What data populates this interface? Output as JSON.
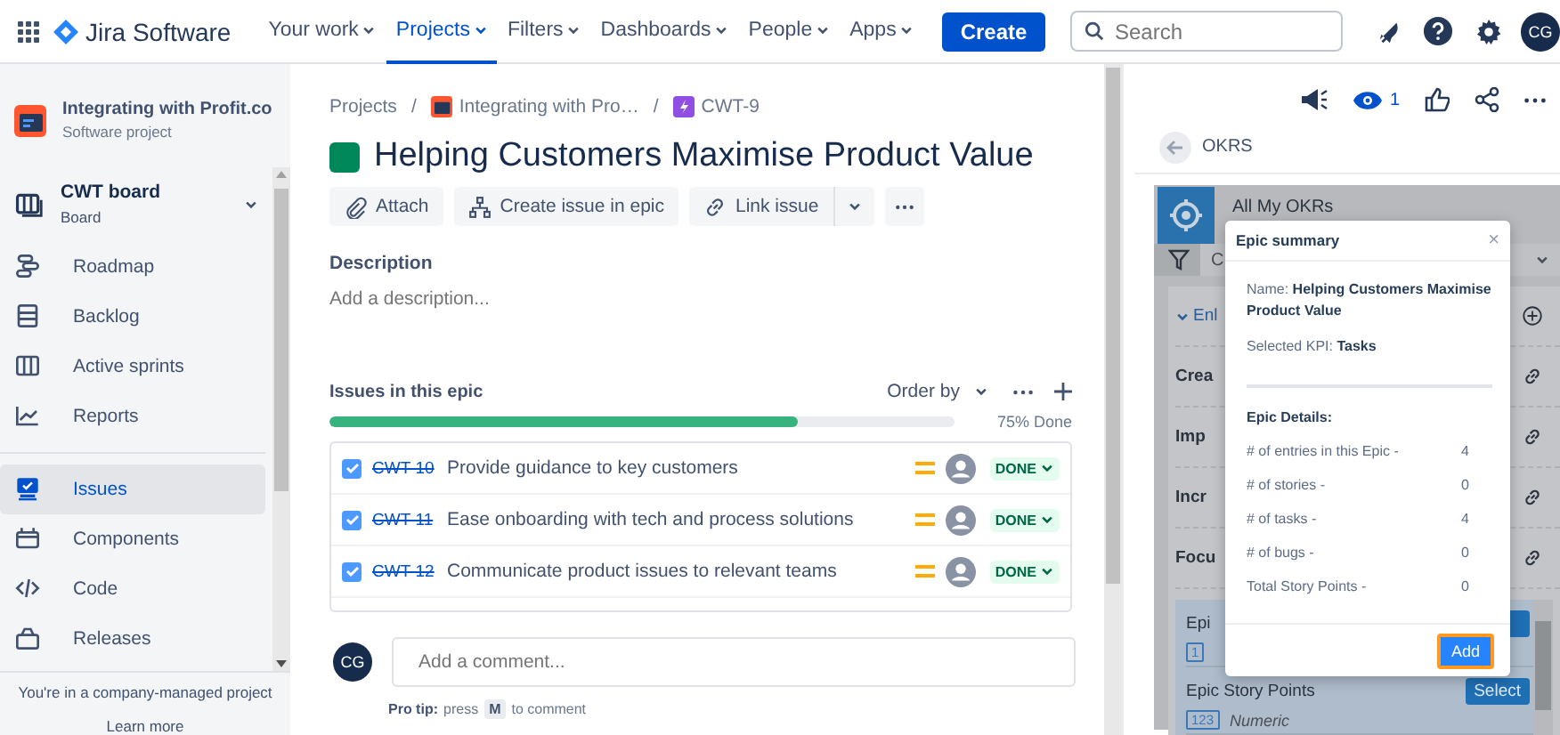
{
  "topbar": {
    "product": "Jira Software",
    "nav": [
      {
        "label": "Your work",
        "selected": false
      },
      {
        "label": "Projects",
        "selected": true
      },
      {
        "label": "Filters",
        "selected": false
      },
      {
        "label": "Dashboards",
        "selected": false
      },
      {
        "label": "People",
        "selected": false
      },
      {
        "label": "Apps",
        "selected": false
      }
    ],
    "create": "Create",
    "search": {
      "placeholder": "Search"
    },
    "avatar": "CG"
  },
  "sidebar": {
    "project": {
      "name": "Integrating with Profit.co",
      "type": "Software project"
    },
    "board": {
      "name": "CWT board",
      "subtitle": "Board"
    },
    "items": [
      {
        "label": "Roadmap",
        "kind": "roadmap",
        "selected": false
      },
      {
        "label": "Backlog",
        "kind": "backlog",
        "selected": false
      },
      {
        "label": "Active sprints",
        "kind": "sprints",
        "selected": false
      },
      {
        "label": "Reports",
        "kind": "reports",
        "selected": false
      },
      {
        "label": "Issues",
        "kind": "issues",
        "selected": true
      },
      {
        "label": "Components",
        "kind": "components",
        "selected": false
      },
      {
        "label": "Code",
        "kind": "code",
        "selected": false
      },
      {
        "label": "Releases",
        "kind": "releases",
        "selected": false
      }
    ],
    "footer": {
      "text": "You're in a company-managed project",
      "link": "Learn more"
    }
  },
  "issue": {
    "breadcrumbs": [
      "Projects",
      "Integrating with Pro…",
      "CWT-9"
    ],
    "breadcrumb_separators": [
      "/",
      "/"
    ],
    "title": "Helping Customers Maximise Product Value",
    "actions": [
      {
        "label": "Attach",
        "kind": "attach"
      },
      {
        "label": "Create issue in epic",
        "kind": "hierarchy"
      },
      {
        "label": "Link issue",
        "kind": "link"
      }
    ],
    "description": {
      "label": "Description",
      "placeholder": "Add a description..."
    },
    "epic": {
      "heading": "Issues in this epic",
      "order_by": "Order by",
      "level": 0.75,
      "progress_text": "75% Done",
      "children": [
        {
          "key": "CWT-10",
          "summary": "Provide guidance to key customers",
          "checked": true,
          "status": "DONE"
        },
        {
          "key": "CWT-11",
          "summary": "Ease onboarding with tech and process solutions",
          "checked": true,
          "status": "DONE"
        },
        {
          "key": "CWT-12",
          "summary": "Communicate product issues to relevant teams",
          "checked": true,
          "status": "DONE"
        }
      ]
    },
    "comment": {
      "avatar": "CG",
      "placeholder": "Add a comment...",
      "tip_label": "Pro tip:",
      "tip_before": "press",
      "key": "M",
      "tip_after": "to comment"
    }
  },
  "panel": {
    "watchers": "1",
    "back_title": "OKRS",
    "okr": {
      "title": "All My OKRs",
      "filter": "C",
      "rows": [
        {
          "label": "Enl",
          "kind": "group"
        },
        {
          "label": "Crea",
          "kind": "link"
        },
        {
          "label": "Imp",
          "kind": "link"
        },
        {
          "label": "Incr",
          "kind": "link"
        },
        {
          "label": "Focu",
          "kind": "link"
        }
      ],
      "fields": [
        {
          "label": "Epi",
          "badge": "1"
        },
        {
          "label": "Epic Story Points",
          "badge": "123",
          "type": "Numeric",
          "button": "Select"
        }
      ]
    },
    "modal": {
      "title": "Epic summary",
      "close": "×",
      "name_label": "Name:",
      "name": "Helping Customers Maximise Product Value",
      "kpi_label": "Selected KPI:",
      "kpi": "Tasks",
      "details_heading": "Epic Details:",
      "details": [
        {
          "label": "# of entries in this Epic -",
          "value": "4"
        },
        {
          "label": "# of stories -",
          "value": "0"
        },
        {
          "label": "# of tasks -",
          "value": "4"
        },
        {
          "label": "# of bugs -",
          "value": "0"
        },
        {
          "label": "Total Story Points -",
          "value": "0"
        }
      ],
      "button": "Add"
    }
  }
}
